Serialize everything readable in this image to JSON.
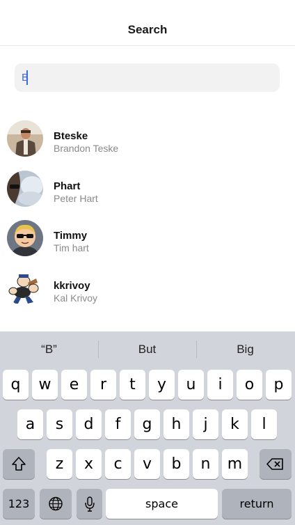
{
  "header": {
    "title": "Search"
  },
  "search": {
    "value": "B"
  },
  "results": [
    {
      "username": "Bteske",
      "full_name": "Brandon Teske",
      "avatar": "photo-man-avatar"
    },
    {
      "username": "Phart",
      "full_name": "Peter Hart",
      "avatar": "photo-sunglasses-avatar"
    },
    {
      "username": "Timmy",
      "full_name": "Tim hart",
      "avatar": "cartoon-sunglasses-avatar"
    },
    {
      "username": "kkrivoy",
      "full_name": "Kal Krivoy",
      "avatar": "popeye-cartoon-avatar"
    }
  ],
  "keyboard": {
    "suggestions": [
      "“B”",
      "But",
      "Big"
    ],
    "row1": [
      "q",
      "w",
      "e",
      "r",
      "t",
      "y",
      "u",
      "i",
      "o",
      "p"
    ],
    "row2": [
      "a",
      "s",
      "d",
      "f",
      "g",
      "h",
      "j",
      "k",
      "l"
    ],
    "row3": [
      "z",
      "x",
      "c",
      "v",
      "b",
      "n",
      "m"
    ],
    "numbers_label": "123",
    "space_label": "space",
    "return_label": "return",
    "icons": {
      "shift": "shift-icon",
      "delete": "backspace-icon",
      "globe": "globe-icon",
      "mic": "microphone-icon"
    }
  }
}
